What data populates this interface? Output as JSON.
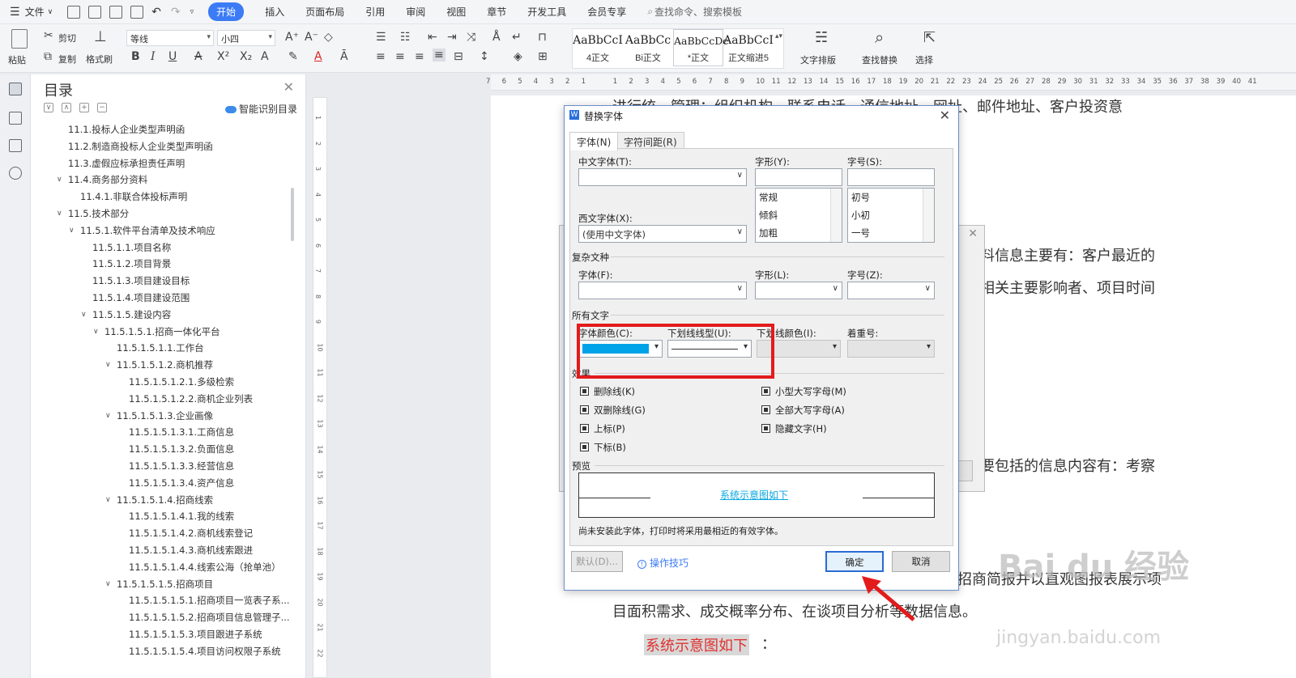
{
  "menubar": {
    "file": "文件",
    "tabs": [
      "开始",
      "插入",
      "页面布局",
      "引用",
      "审阅",
      "视图",
      "章节",
      "开发工具",
      "会员专享"
    ],
    "search": "查找命令、搜索模板"
  },
  "ribbon": {
    "paste": "粘贴",
    "cut": "剪切",
    "copy": "复制",
    "format_painter": "格式刷",
    "font_name": "等线",
    "font_size": "小四",
    "styles": [
      {
        "preview": "AaBbCcI",
        "name": "4正文"
      },
      {
        "preview": "AaBbCc",
        "name": "Bi正文"
      },
      {
        "preview": "AaBbCcDc",
        "name": "*正文"
      },
      {
        "preview": "AaBbCcI",
        "name": "正文缩进5"
      }
    ],
    "text_layout": "文字排版",
    "find_replace": "查找替换",
    "select": "选择"
  },
  "toc": {
    "title": "目录",
    "smart": "智能识别目录",
    "items": [
      {
        "indent": 0,
        "chev": "",
        "text": "11.1.投标人企业类型声明函"
      },
      {
        "indent": 0,
        "chev": "",
        "text": "11.2.制造商投标人企业类型声明函"
      },
      {
        "indent": 0,
        "chev": "",
        "text": "11.3.虚假应标承担责任声明"
      },
      {
        "indent": 0,
        "chev": "∨",
        "text": "11.4.商务部分资料"
      },
      {
        "indent": 1,
        "chev": "",
        "text": "11.4.1.非联合体投标声明"
      },
      {
        "indent": 0,
        "chev": "∨",
        "text": "11.5.技术部分"
      },
      {
        "indent": 1,
        "chev": "∨",
        "text": "11.5.1.软件平台清单及技术响应"
      },
      {
        "indent": 2,
        "chev": "",
        "text": "11.5.1.1.项目名称"
      },
      {
        "indent": 2,
        "chev": "",
        "text": "11.5.1.2.项目背景"
      },
      {
        "indent": 2,
        "chev": "",
        "text": "11.5.1.3.项目建设目标"
      },
      {
        "indent": 2,
        "chev": "",
        "text": "11.5.1.4.项目建设范围"
      },
      {
        "indent": 2,
        "chev": "∨",
        "text": "11.5.1.5.建设内容"
      },
      {
        "indent": 3,
        "chev": "∨",
        "text": "11.5.1.5.1.招商一体化平台"
      },
      {
        "indent": 4,
        "chev": "",
        "text": "11.5.1.5.1.1.工作台"
      },
      {
        "indent": 4,
        "chev": "∨",
        "text": "11.5.1.5.1.2.商机推荐"
      },
      {
        "indent": 5,
        "chev": "",
        "text": "11.5.1.5.1.2.1.多级检索"
      },
      {
        "indent": 5,
        "chev": "",
        "text": "11.5.1.5.1.2.2.商机企业列表"
      },
      {
        "indent": 4,
        "chev": "∨",
        "text": "11.5.1.5.1.3.企业画像"
      },
      {
        "indent": 5,
        "chev": "",
        "text": "11.5.1.5.1.3.1.工商信息"
      },
      {
        "indent": 5,
        "chev": "",
        "text": "11.5.1.5.1.3.2.负面信息"
      },
      {
        "indent": 5,
        "chev": "",
        "text": "11.5.1.5.1.3.3.经营信息"
      },
      {
        "indent": 5,
        "chev": "",
        "text": "11.5.1.5.1.3.4.资产信息"
      },
      {
        "indent": 4,
        "chev": "∨",
        "text": "11.5.1.5.1.4.招商线索"
      },
      {
        "indent": 5,
        "chev": "",
        "text": "11.5.1.5.1.4.1.我的线索"
      },
      {
        "indent": 5,
        "chev": "",
        "text": "11.5.1.5.1.4.2.商机线索登记"
      },
      {
        "indent": 5,
        "chev": "",
        "text": "11.5.1.5.1.4.3.商机线索跟进"
      },
      {
        "indent": 5,
        "chev": "",
        "text": "11.5.1.5.1.4.4.线索公海（抢单池）"
      },
      {
        "indent": 4,
        "chev": "∨",
        "text": "11.5.1.5.1.5.招商项目"
      },
      {
        "indent": 5,
        "chev": "",
        "text": "11.5.1.5.1.5.1.招商项目一览表子系..."
      },
      {
        "indent": 5,
        "chev": "",
        "text": "11.5.1.5.1.5.2.招商项目信息管理子..."
      },
      {
        "indent": 5,
        "chev": "",
        "text": "11.5.1.5.1.5.3.项目跟进子系统"
      },
      {
        "indent": 5,
        "chev": "",
        "text": "11.5.1.5.1.5.4.项目访问权限子系统"
      }
    ]
  },
  "hruler": [
    "7",
    "6",
    "5",
    "4",
    "3",
    "2",
    "1",
    "",
    "1",
    "2",
    "3",
    "4",
    "5",
    "6",
    "7",
    "8",
    "9",
    "10",
    "11",
    "12",
    "13",
    "14",
    "15",
    "16",
    "17",
    "18",
    "19",
    "20",
    "21",
    "22",
    "23",
    "24",
    "25",
    "26",
    "27",
    "28",
    "29",
    "30",
    "31",
    "32",
    "33",
    "34",
    "35",
    "36",
    "37",
    "38",
    "39",
    "40",
    "41"
  ],
  "vruler": [
    "1",
    "2",
    "3",
    "4",
    "5",
    "6",
    "7",
    "8",
    "9",
    "10",
    "11",
    "12",
    "13",
    "14",
    "15",
    "16",
    "17",
    "18",
    "19",
    "20",
    "21",
    "22"
  ],
  "doc": {
    "line1": "进行统一管理：组织机构、联系电话、通信地址、网址、邮件地址、客户投资意",
    "line2": "料信息主要有：客户最近的",
    "line3": "相关主要影响者、项目时间",
    "line4": "要包括的信息内容有：考察",
    "line5": "招商简报并以直观图报表展示项",
    "line6": "目面积需求、成交概率分布、在谈项目分析等数据信息。",
    "highlight": "系统示意图如下",
    "colon": "："
  },
  "dialog": {
    "title": "替换字体",
    "tab_font": "字体(N)",
    "tab_spacing": "字符间距(R)",
    "cn_font_label": "中文字体(T):",
    "cn_font_value": "",
    "style_label": "字形(Y):",
    "size_label": "字号(S):",
    "style_list": [
      "常规",
      "倾斜",
      "加粗"
    ],
    "size_list": [
      "初号",
      "小初",
      "一号"
    ],
    "west_font_label": "西文字体(X):",
    "west_font_value": "(使用中文字体)",
    "complex_section": "复杂文种",
    "complex_font_label": "字体(F):",
    "complex_style_label": "字形(L):",
    "complex_size_label": "字号(Z):",
    "all_text_section": "所有文字",
    "font_color_label": "字体颜色(C):",
    "font_color": "#00a2e8",
    "underline_label": "下划线线型(U):",
    "underline_color_label": "下划线颜色(I):",
    "emphasis_label": "着重号:",
    "effects_section": "效果",
    "effects": {
      "strike": "删除线(K)",
      "double_strike": "双删除线(G)",
      "superscript": "上标(P)",
      "subscript": "下标(B)",
      "small_caps": "小型大写字母(M)",
      "all_caps": "全部大写字母(A)",
      "hidden": "隐藏文字(H)"
    },
    "preview_section": "预览",
    "preview_text": "系统示意图如下",
    "note": "尚未安装此字体，打印时将采用最相近的有效字体。",
    "default_btn": "默认(D)...",
    "tips_link": "操作技巧",
    "ok_btn": "确定",
    "cancel_btn": "取消"
  },
  "watermark": {
    "brand": "Bai du 经验",
    "url": "jingyan.baidu.com"
  },
  "colors": {
    "accent": "#3c7bf6",
    "highlight_box": "#e31b1b",
    "doc_red": "#e0302f"
  }
}
